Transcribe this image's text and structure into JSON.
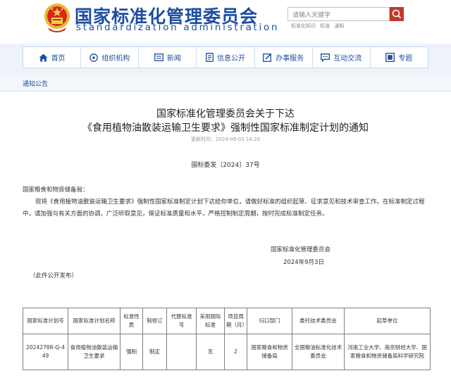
{
  "header": {
    "title": "国家标准化管理委员会",
    "subtitle": "standardization administration",
    "search_placeholder": "请输入关键字",
    "hot_words": [
      "标准化知识",
      "标准",
      "通知"
    ]
  },
  "nav": [
    {
      "label": "首页",
      "icon": "home-icon"
    },
    {
      "label": "组织机构",
      "icon": "org-icon"
    },
    {
      "label": "新闻",
      "icon": "news-icon"
    },
    {
      "label": "信息公开",
      "icon": "info-icon"
    },
    {
      "label": "办事服务",
      "icon": "service-icon"
    },
    {
      "label": "互动交流",
      "icon": "chat-icon"
    },
    {
      "label": "专题",
      "icon": "topic-icon"
    }
  ],
  "breadcrumb": "通知公告",
  "article": {
    "title_line1": "国家标准化管理委员会关于下达",
    "title_line2": "《食用植物油散装运输卫生要求》强制性国家标准制定计划的通知",
    "updated": "更新时间：2024-09-03 16:20",
    "doc_no": "国标委发〔2024〕37号",
    "salutation": "国家粮食和物资储备局：",
    "body": "现将《食用植物油散装运输卫生要求》强制性国家标准制定计划下达给你单位，请做好标准的组织起草、征求意见和技术审查工作。在标准制定过程中，请加强与有关方面的协调，广泛听取意见，保证标准质量和水平，严格控制制定周期，按时完成标准制定任务。",
    "signature": "国家标准化管理委员会",
    "date": "2024年9月3日",
    "note": "（此件公开发布）"
  },
  "table": {
    "headers": [
      "国家标准计划号",
      "国家标准计划名称",
      "标准性质",
      "制修订",
      "代替标准号",
      "采用国际标准",
      "项目周期（月）",
      "归口部门",
      "委托技术委员会",
      "起草单位"
    ],
    "rows": [
      [
        "20242788-Q-449",
        "食用植物油散装运输卫生要求",
        "强制",
        "制定",
        "",
        "无",
        "2",
        "国家粮食和物资储备局",
        "全国粮油标准化技术委员会",
        "河南工业大学、南京财经大学、国家粮食和物资储备局科学研究院"
      ]
    ]
  },
  "colors": {
    "brand_blue": "#1e4e9e",
    "search_red": "#c0392b",
    "emblem_red": "#d42a20",
    "emblem_gold": "#e8b830"
  }
}
